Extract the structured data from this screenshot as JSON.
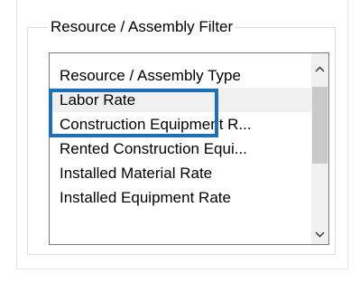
{
  "group": {
    "title": "Resource / Assembly Filter"
  },
  "list": {
    "items": [
      {
        "label": "Resource / Assembly Type"
      },
      {
        "label": "Labor Rate"
      },
      {
        "label": "Construction Equipment R..."
      },
      {
        "label": "Rented Construction Equi..."
      },
      {
        "label": "Installed Material Rate"
      },
      {
        "label": "Installed Equipment Rate"
      }
    ],
    "selected": "Labor Rate"
  },
  "scrollbar": {
    "up_icon": "chevron-up-icon",
    "down_icon": "chevron-down-icon"
  },
  "colors": {
    "highlight": "#1d6fb8",
    "selection_bg": "#f0f0f0",
    "scroll_thumb": "#c9c9c9"
  }
}
